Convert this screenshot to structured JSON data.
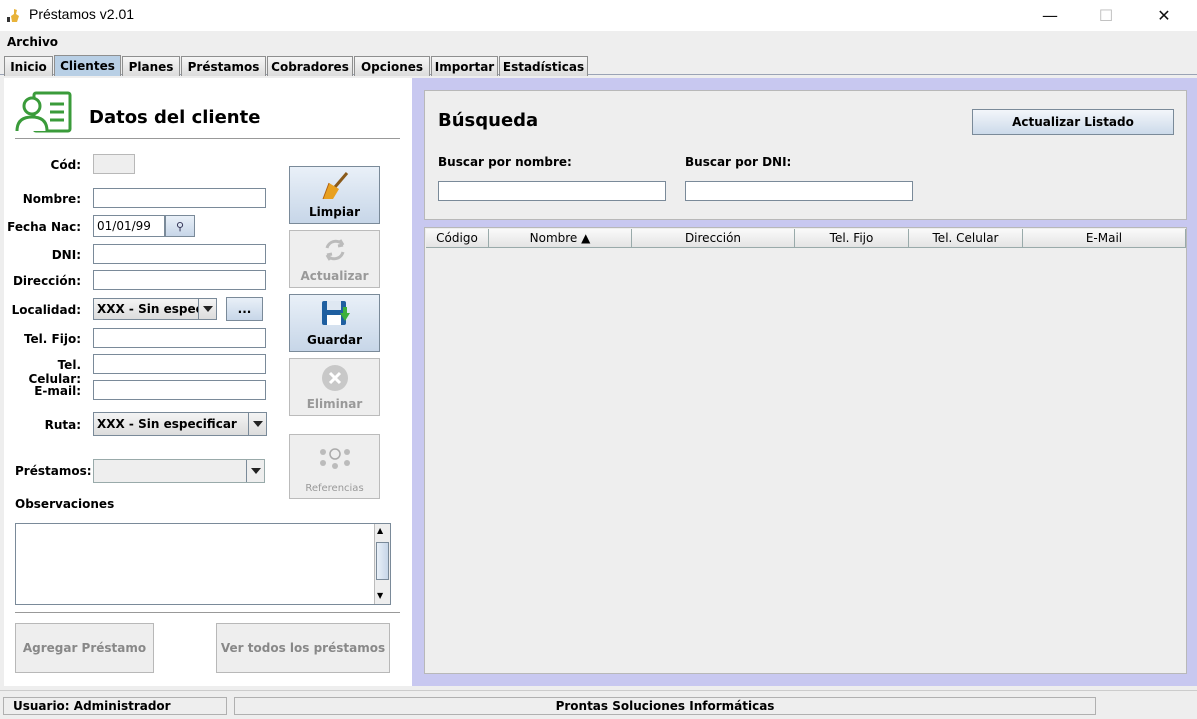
{
  "window": {
    "title": "Préstamos v2.01",
    "minimize": "—",
    "maximize": "☐",
    "close": "✕"
  },
  "menu": {
    "archivo": "Archivo"
  },
  "tabs": [
    {
      "label": "Inicio"
    },
    {
      "label": "Clientes"
    },
    {
      "label": "Planes"
    },
    {
      "label": "Préstamos"
    },
    {
      "label": "Cobradores"
    },
    {
      "label": "Opciones"
    },
    {
      "label": "Importar"
    },
    {
      "label": "Estadísticas"
    }
  ],
  "active_tab": "Clientes",
  "client": {
    "header": "Datos del cliente",
    "cod_label": "Cód:",
    "nombre_label": "Nombre:",
    "fecha_label": "Fecha Nac:",
    "fecha_value": "01/01/99",
    "dni_label": "DNI:",
    "direccion_label": "Dirección:",
    "localidad_label": "Localidad:",
    "localidad_value": "XXX - Sin espec...",
    "localidad_more": "...",
    "telfijo_label": "Tel. Fijo:",
    "telcel_label": "Tel. Celular:",
    "email_label": "E-mail:",
    "ruta_label": "Ruta:",
    "ruta_value": "XXX - Sin especificar",
    "prestamos_label": "Préstamos:",
    "observaciones_label": "Observaciones"
  },
  "actions": {
    "limpiar": "Limpiar",
    "actualizar": "Actualizar",
    "guardar": "Guardar",
    "eliminar": "Eliminar",
    "referencias": "Referencias",
    "agregar_prestamo": "Agregar Préstamo",
    "ver_todos": "Ver todos los préstamos"
  },
  "search": {
    "title": "Búsqueda",
    "refresh": "Actualizar Listado",
    "by_name_label": "Buscar por nombre:",
    "by_dni_label": "Buscar por DNI:"
  },
  "table": {
    "columns": [
      "Código",
      "Nombre ▲",
      "Dirección",
      "Tel. Fijo",
      "Tel. Celular",
      "E-Mail"
    ]
  },
  "status": {
    "user_label": "Usuario:",
    "user_value": "Administrador",
    "company": "Prontas Soluciones Informáticas"
  }
}
